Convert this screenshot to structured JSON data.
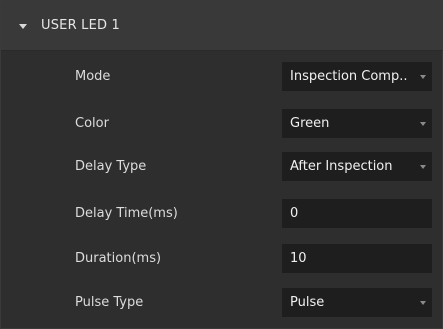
{
  "section": {
    "title": "USER LED 1"
  },
  "rows": [
    {
      "label": "Mode",
      "value": "Inspection Comp...",
      "control": "dropdown"
    },
    {
      "label": "Color",
      "value": "Green",
      "control": "dropdown"
    },
    {
      "label": "Delay Type",
      "value": "After Inspection",
      "control": "dropdown"
    },
    {
      "label": "Delay Time(ms)",
      "value": "0",
      "control": "text"
    },
    {
      "label": "Duration(ms)",
      "value": "10",
      "control": "text"
    },
    {
      "label": "Pulse Type",
      "value": "Pulse",
      "control": "dropdown"
    }
  ],
  "colors": {
    "panel_bg": "#2e2e2e",
    "header_bg": "#393939",
    "field_bg": "#1e1e1e",
    "text": "#dcdcdc"
  },
  "icons": {
    "collapse": "caret-down-icon",
    "dropdown": "chevron-down-icon"
  }
}
